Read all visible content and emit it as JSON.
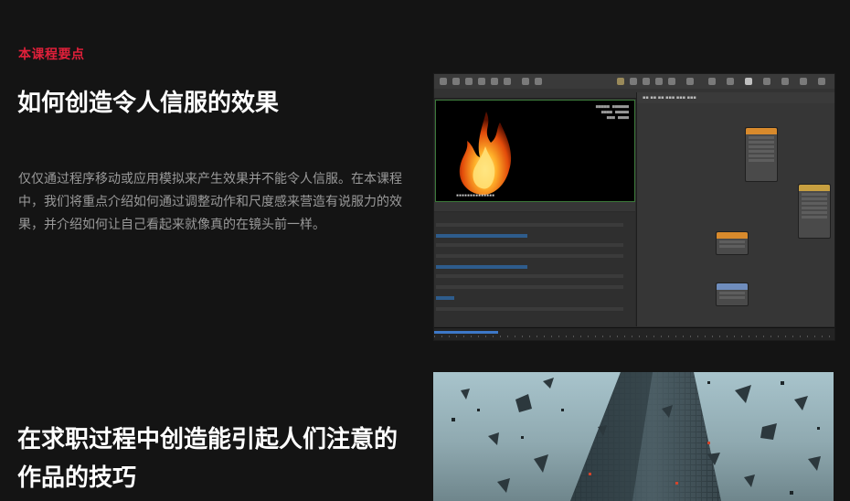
{
  "section": {
    "eyebrow": "本课程要点",
    "headline": "如何创造令人信服的效果",
    "description": "仅仅通过程序移动或应用模拟来产生效果并不能令人信服。在本课程中，我们将重点介绍如何通过调整动作和尺度感来营造有说服力的效果，并介绍如何让自己看起来就像真的在镜头前一样。",
    "headline2": "在求职过程中创造能引起人们注意的作品的技巧"
  },
  "images": {
    "software_screenshot": "houdini-fire-simulation-ui",
    "building_destruction": "shattering-skyscraper-render"
  },
  "colors": {
    "background": "#141414",
    "accent": "#e0203a",
    "headline": "#ffffff",
    "body_text": "#9a9a9a"
  }
}
